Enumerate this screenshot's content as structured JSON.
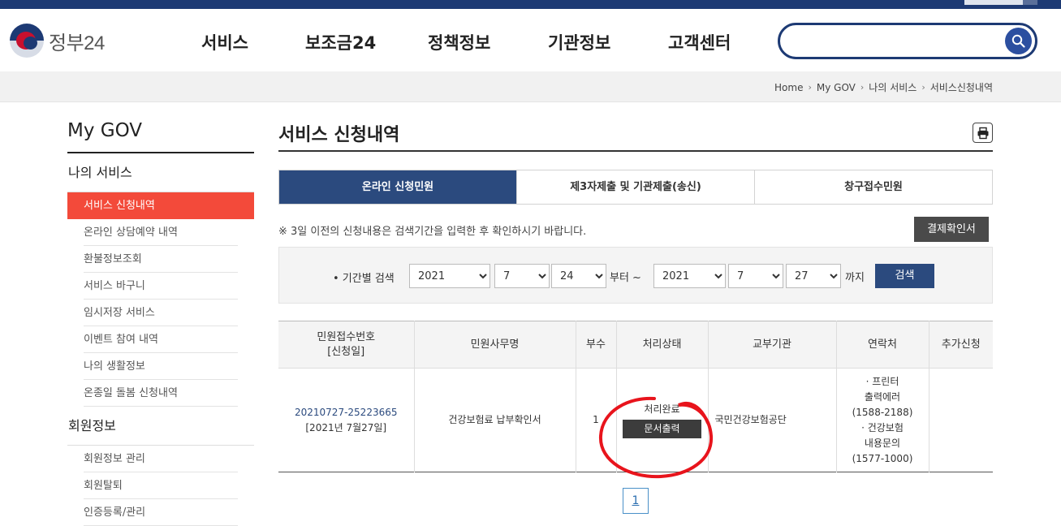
{
  "brand": {
    "logo_text": "정부24"
  },
  "gnb": [
    "서비스",
    "보조금24",
    "정책정보",
    "기관정보",
    "고객센터"
  ],
  "search": {
    "placeholder": "",
    "value": ""
  },
  "breadcrumb": [
    "Home",
    "My GOV",
    "나의 서비스",
    "서비스신청내역"
  ],
  "sidebar": {
    "title": "My GOV",
    "groups": [
      {
        "label": "나의 서비스",
        "items": [
          "서비스 신청내역",
          "온라인 상담예약 내역",
          "환불정보조회",
          "서비스 바구니",
          "임시저장 서비스",
          "이벤트 참여 내역",
          "나의 생활정보",
          "온종일 돌봄 신청내역"
        ]
      },
      {
        "label": "회원정보",
        "items": [
          "회원정보 관리",
          "회원탈퇴",
          "인증등록/관리"
        ]
      }
    ],
    "active_item": "서비스 신청내역"
  },
  "page": {
    "title": "서비스 신청내역",
    "tabs": [
      "온라인 신청민원",
      "제3자제출 및 기관제출(송신)",
      "창구접수민원"
    ],
    "active_tab": "온라인 신청민원",
    "notice": "※ 3일 이전의 신청내용은 검색기간을 입력한 후 확인하시기 바랍니다.",
    "confirm_button": "결제확인서"
  },
  "filter": {
    "label": "• 기간별 검색",
    "from": {
      "year": "2021",
      "month": "7",
      "day": "24"
    },
    "from_word": "부터 ~",
    "to": {
      "year": "2021",
      "month": "7",
      "day": "27"
    },
    "to_word": "까지",
    "search_button": "검색"
  },
  "table": {
    "headers": [
      "민원접수번호\n[신청일]",
      "민원사무명",
      "부수",
      "처리상태",
      "교부기관",
      "연락처",
      "추가신청"
    ],
    "header_line1": "민원접수번호",
    "header_line2": "[신청일]",
    "rows": [
      {
        "receipt_no": "20210727-25223665",
        "date": "[2021년 7월27일]",
        "service": "건강보험료 납부확인서",
        "copies": "1",
        "status": "처리완료",
        "action": "문서출력",
        "agency": "국민건강보험공단",
        "contact": [
          "· 프린터",
          "출력에러",
          "(1588-2188)",
          "· 건강보험",
          "내용문의",
          "(1577-1000)"
        ],
        "extra": ""
      }
    ]
  },
  "pagination": {
    "current": "1"
  },
  "annotation_color": "#e8141c"
}
